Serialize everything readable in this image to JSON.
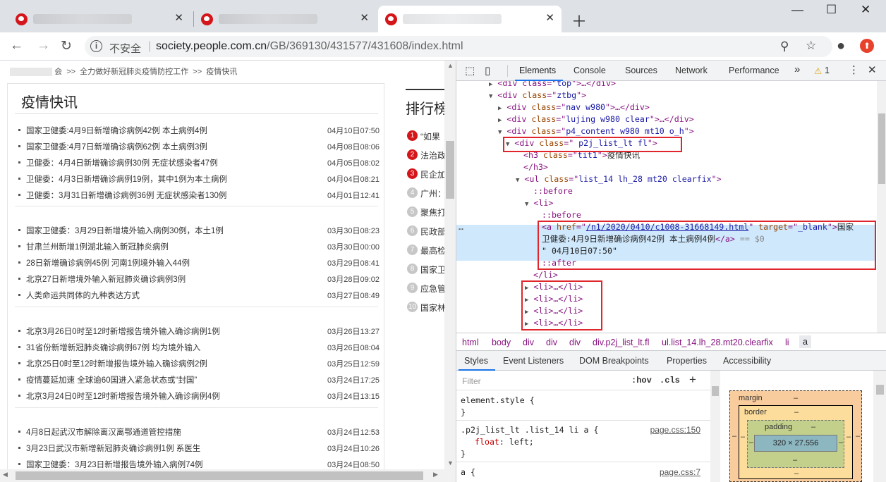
{
  "browser": {
    "tabs": [
      {
        "title": ""
      },
      {
        "title": ""
      },
      {
        "title": ""
      }
    ],
    "address": {
      "security_label": "不安全",
      "host": "society.people.com.cn",
      "path": "/GB/369130/431577/431608/index.html"
    }
  },
  "page": {
    "breadcrumb": {
      "blurred": "",
      "part1": "会",
      "sep1": ">>",
      "part2": "全力做好新冠肺炎疫情防控工作",
      "sep2": ">>",
      "part3": "疫情快讯"
    },
    "news_title": "疫情快讯",
    "news": [
      {
        "title": "国家卫健委:4月9日新增确诊病例42例 本土病例4例",
        "date": "04月10日07:50"
      },
      {
        "title": "国家卫健委:4月7日新增确诊病例62例 本土病例3例",
        "date": "04月08日08:06"
      },
      {
        "title": "卫健委：4月4日新增确诊病例30例 无症状感染者47例",
        "date": "04月05日08:02"
      },
      {
        "title": "卫健委：4月3日新增确诊病例19例，其中1例为本土病例",
        "date": "04月04日08:21"
      },
      {
        "title": "卫健委：3月31日新增确诊病例36例 无症状感染者130例",
        "date": "04月01日12:41"
      },
      {
        "title": "国家卫健委：3月29日新增境外输入病例30例，本土1例",
        "date": "03月30日08:23"
      },
      {
        "title": "甘肃兰州新增1例湖北输入新冠肺炎病例",
        "date": "03月30日00:00"
      },
      {
        "title": "28日新增确诊病例45例 河南1例境外输入44例",
        "date": "03月29日08:41"
      },
      {
        "title": "北京27日新增境外输入新冠肺炎确诊病例3例",
        "date": "03月28日09:02"
      },
      {
        "title": "人类命运共同体的九种表达方式",
        "date": "03月27日08:49"
      },
      {
        "title": "北京3月26日0时至12时新增报告境外输入确诊病例1例",
        "date": "03月26日13:27"
      },
      {
        "title": "31省份新增新冠肺炎确诊病例67例 均为境外输入",
        "date": "03月26日08:04"
      },
      {
        "title": "北京25日0时至12时新增报告境外输入确诊病例2例",
        "date": "03月25日12:59"
      },
      {
        "title": "疫情蔓延加速 全球逾60国进入紧急状态或“封国”",
        "date": "03月24日17:25"
      },
      {
        "title": "北京3月24日0时至12时新增报告境外输入确诊病例4例",
        "date": "03月24日13:15"
      },
      {
        "title": "4月8日起武汉市解除离汉离鄂通道管控措施",
        "date": "03月24日12:53"
      },
      {
        "title": "3月23日武汉市新增新冠肺炎确诊病例1例 系医生",
        "date": "03月24日10:26"
      },
      {
        "title": "国家卫健委：3月23日新增报告境外输入病例74例",
        "date": "03月24日08:50"
      }
    ],
    "rank_title": "排行榜",
    "rank": [
      {
        "num": "1",
        "text": "“如果"
      },
      {
        "num": "2",
        "text": "法治政"
      },
      {
        "num": "3",
        "text": "民企加"
      },
      {
        "num": "4",
        "text": "广州："
      },
      {
        "num": "5",
        "text": "聚焦打"
      },
      {
        "num": "6",
        "text": "民政部"
      },
      {
        "num": "7",
        "text": "最高检"
      },
      {
        "num": "8",
        "text": "国家卫"
      },
      {
        "num": "9",
        "text": "应急管"
      },
      {
        "num": "10",
        "text": "国家林"
      }
    ]
  },
  "devtools": {
    "tabs": [
      "Elements",
      "Console",
      "Sources",
      "Network",
      "Performance"
    ],
    "more": "»",
    "warning_count": "1",
    "dom": {
      "l0_pre": "<div class=\"",
      "l0_val": "top",
      "l0_post": "\">…</div>",
      "l1_attr": "ztbg",
      "l2_val": "nav w980",
      "l3_val": "lujing w980 clear",
      "l4_val": "p4_content w980 mt10 o_h",
      "l5_val": " p2j_list_lt fl",
      "l6_val": "tit1",
      "l6_text": "疫情快讯",
      "l7": "</h3>",
      "l8_val": "list_14 lh_28 mt20 clearfix",
      "before": "::before",
      "li_open": "<li>",
      "href": "/n1/2020/0410/c1008-31668149.html",
      "target": "_blank",
      "a_text1": "国家",
      "a_text2": "卫健委:4月9日新增确诊病例42例 本土病例4例",
      "eq": "== $0",
      "date_text": "\" 04月10日07:50\"",
      "after": "::after",
      "li_close": "</li>",
      "li_collapsed": "<li>…</li>",
      "ellipsis": "…"
    },
    "breadcrumbs": [
      "html",
      "body",
      "div",
      "div",
      "div",
      "div.p2j_list_lt.fl",
      "ul.list_14.lh_28.mt20.clearfix",
      "li",
      "a"
    ],
    "sub_tabs": [
      "Styles",
      "Event Listeners",
      "DOM Breakpoints",
      "Properties",
      "Accessibility"
    ],
    "styles": {
      "filter_placeholder": "Filter",
      "hov": ":hov",
      "cls": ".cls",
      "element_style": "element.style {",
      "close_brace": "}",
      "rule1_selector": ".p2j_list_lt .list_14 li a {",
      "rule1_source": "page.css:150",
      "rule1_prop": "float",
      "rule1_value": "left;",
      "rule2_selector": "a {",
      "rule2_source": "page.css:7"
    },
    "box_model": {
      "margin_label": "margin",
      "margin_value": "–",
      "border_label": "border",
      "border_value": "–",
      "padding_label": "padding",
      "padding_value": "–",
      "content": "320 × 27.556",
      "dash": "–"
    }
  }
}
